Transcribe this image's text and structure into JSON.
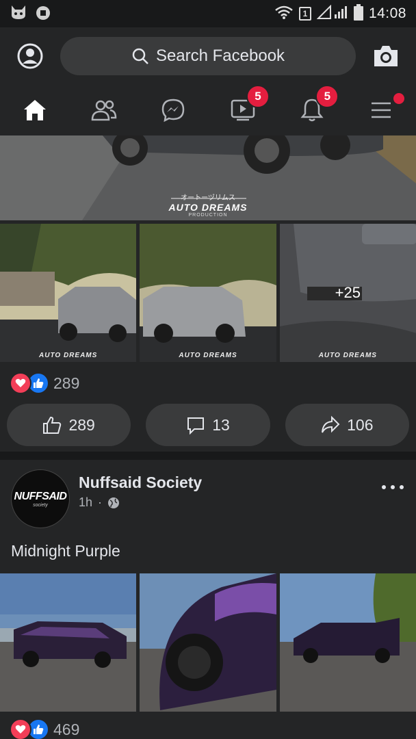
{
  "status_bar": {
    "time": "14:08",
    "sim_indicator": "1",
    "icons": [
      "cat-notification-icon",
      "app-notification-icon",
      "wifi-icon",
      "sim-icon",
      "signal-icon",
      "battery-icon"
    ]
  },
  "header": {
    "search_placeholder": "Search Facebook",
    "icons": [
      "profile-icon",
      "search-icon",
      "camera-icon"
    ]
  },
  "nav": {
    "tabs": [
      {
        "name": "home",
        "icon": "home-icon",
        "active": true
      },
      {
        "name": "friends",
        "icon": "friends-icon"
      },
      {
        "name": "messenger",
        "icon": "messenger-icon"
      },
      {
        "name": "watch",
        "icon": "watch-icon",
        "badge": "5"
      },
      {
        "name": "notifications",
        "icon": "bell-icon",
        "badge": "5"
      },
      {
        "name": "menu",
        "icon": "menu-icon",
        "dot": true
      }
    ]
  },
  "post1": {
    "watermark": {
      "japanese": "オートーヅリムス",
      "brand": "AUTO DREAMS",
      "sub": "PRODUCTION"
    },
    "grid_watermark": "AUTO DREAMS",
    "more_photos": "+25",
    "reaction_count": "289",
    "actions": {
      "like": "289",
      "comment": "13",
      "share": "106"
    }
  },
  "post2": {
    "page_name": "Nuffsaid Society",
    "time": "1h",
    "separator": "·",
    "avatar_text": "NUFFSAID",
    "avatar_subtext": "society",
    "text": "Midnight Purple",
    "reaction_count": "469"
  },
  "colors": {
    "background": "#18191a",
    "surface": "#242526",
    "button": "#3a3b3c",
    "badge": "#e41e3f",
    "like_blue": "#1877f2",
    "love_red": "#f33e58"
  }
}
